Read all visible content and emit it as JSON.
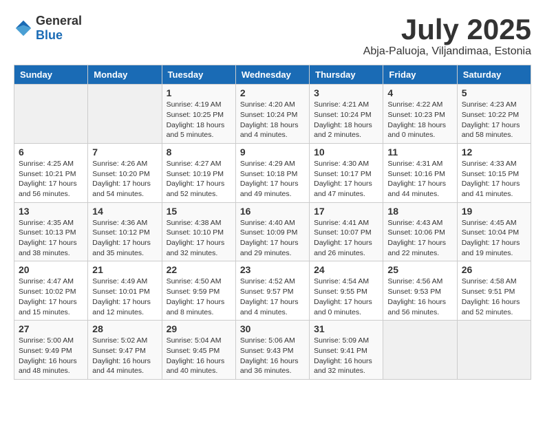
{
  "header": {
    "logo_general": "General",
    "logo_blue": "Blue",
    "month_title": "July 2025",
    "location": "Abja-Paluoja, Viljandimaa, Estonia"
  },
  "weekdays": [
    "Sunday",
    "Monday",
    "Tuesday",
    "Wednesday",
    "Thursday",
    "Friday",
    "Saturday"
  ],
  "weeks": [
    [
      {
        "day": "",
        "info": ""
      },
      {
        "day": "",
        "info": ""
      },
      {
        "day": "1",
        "info": "Sunrise: 4:19 AM\nSunset: 10:25 PM\nDaylight: 18 hours\nand 5 minutes."
      },
      {
        "day": "2",
        "info": "Sunrise: 4:20 AM\nSunset: 10:24 PM\nDaylight: 18 hours\nand 4 minutes."
      },
      {
        "day": "3",
        "info": "Sunrise: 4:21 AM\nSunset: 10:24 PM\nDaylight: 18 hours\nand 2 minutes."
      },
      {
        "day": "4",
        "info": "Sunrise: 4:22 AM\nSunset: 10:23 PM\nDaylight: 18 hours\nand 0 minutes."
      },
      {
        "day": "5",
        "info": "Sunrise: 4:23 AM\nSunset: 10:22 PM\nDaylight: 17 hours\nand 58 minutes."
      }
    ],
    [
      {
        "day": "6",
        "info": "Sunrise: 4:25 AM\nSunset: 10:21 PM\nDaylight: 17 hours\nand 56 minutes."
      },
      {
        "day": "7",
        "info": "Sunrise: 4:26 AM\nSunset: 10:20 PM\nDaylight: 17 hours\nand 54 minutes."
      },
      {
        "day": "8",
        "info": "Sunrise: 4:27 AM\nSunset: 10:19 PM\nDaylight: 17 hours\nand 52 minutes."
      },
      {
        "day": "9",
        "info": "Sunrise: 4:29 AM\nSunset: 10:18 PM\nDaylight: 17 hours\nand 49 minutes."
      },
      {
        "day": "10",
        "info": "Sunrise: 4:30 AM\nSunset: 10:17 PM\nDaylight: 17 hours\nand 47 minutes."
      },
      {
        "day": "11",
        "info": "Sunrise: 4:31 AM\nSunset: 10:16 PM\nDaylight: 17 hours\nand 44 minutes."
      },
      {
        "day": "12",
        "info": "Sunrise: 4:33 AM\nSunset: 10:15 PM\nDaylight: 17 hours\nand 41 minutes."
      }
    ],
    [
      {
        "day": "13",
        "info": "Sunrise: 4:35 AM\nSunset: 10:13 PM\nDaylight: 17 hours\nand 38 minutes."
      },
      {
        "day": "14",
        "info": "Sunrise: 4:36 AM\nSunset: 10:12 PM\nDaylight: 17 hours\nand 35 minutes."
      },
      {
        "day": "15",
        "info": "Sunrise: 4:38 AM\nSunset: 10:10 PM\nDaylight: 17 hours\nand 32 minutes."
      },
      {
        "day": "16",
        "info": "Sunrise: 4:40 AM\nSunset: 10:09 PM\nDaylight: 17 hours\nand 29 minutes."
      },
      {
        "day": "17",
        "info": "Sunrise: 4:41 AM\nSunset: 10:07 PM\nDaylight: 17 hours\nand 26 minutes."
      },
      {
        "day": "18",
        "info": "Sunrise: 4:43 AM\nSunset: 10:06 PM\nDaylight: 17 hours\nand 22 minutes."
      },
      {
        "day": "19",
        "info": "Sunrise: 4:45 AM\nSunset: 10:04 PM\nDaylight: 17 hours\nand 19 minutes."
      }
    ],
    [
      {
        "day": "20",
        "info": "Sunrise: 4:47 AM\nSunset: 10:02 PM\nDaylight: 17 hours\nand 15 minutes."
      },
      {
        "day": "21",
        "info": "Sunrise: 4:49 AM\nSunset: 10:01 PM\nDaylight: 17 hours\nand 12 minutes."
      },
      {
        "day": "22",
        "info": "Sunrise: 4:50 AM\nSunset: 9:59 PM\nDaylight: 17 hours\nand 8 minutes."
      },
      {
        "day": "23",
        "info": "Sunrise: 4:52 AM\nSunset: 9:57 PM\nDaylight: 17 hours\nand 4 minutes."
      },
      {
        "day": "24",
        "info": "Sunrise: 4:54 AM\nSunset: 9:55 PM\nDaylight: 17 hours\nand 0 minutes."
      },
      {
        "day": "25",
        "info": "Sunrise: 4:56 AM\nSunset: 9:53 PM\nDaylight: 16 hours\nand 56 minutes."
      },
      {
        "day": "26",
        "info": "Sunrise: 4:58 AM\nSunset: 9:51 PM\nDaylight: 16 hours\nand 52 minutes."
      }
    ],
    [
      {
        "day": "27",
        "info": "Sunrise: 5:00 AM\nSunset: 9:49 PM\nDaylight: 16 hours\nand 48 minutes."
      },
      {
        "day": "28",
        "info": "Sunrise: 5:02 AM\nSunset: 9:47 PM\nDaylight: 16 hours\nand 44 minutes."
      },
      {
        "day": "29",
        "info": "Sunrise: 5:04 AM\nSunset: 9:45 PM\nDaylight: 16 hours\nand 40 minutes."
      },
      {
        "day": "30",
        "info": "Sunrise: 5:06 AM\nSunset: 9:43 PM\nDaylight: 16 hours\nand 36 minutes."
      },
      {
        "day": "31",
        "info": "Sunrise: 5:09 AM\nSunset: 9:41 PM\nDaylight: 16 hours\nand 32 minutes."
      },
      {
        "day": "",
        "info": ""
      },
      {
        "day": "",
        "info": ""
      }
    ]
  ]
}
